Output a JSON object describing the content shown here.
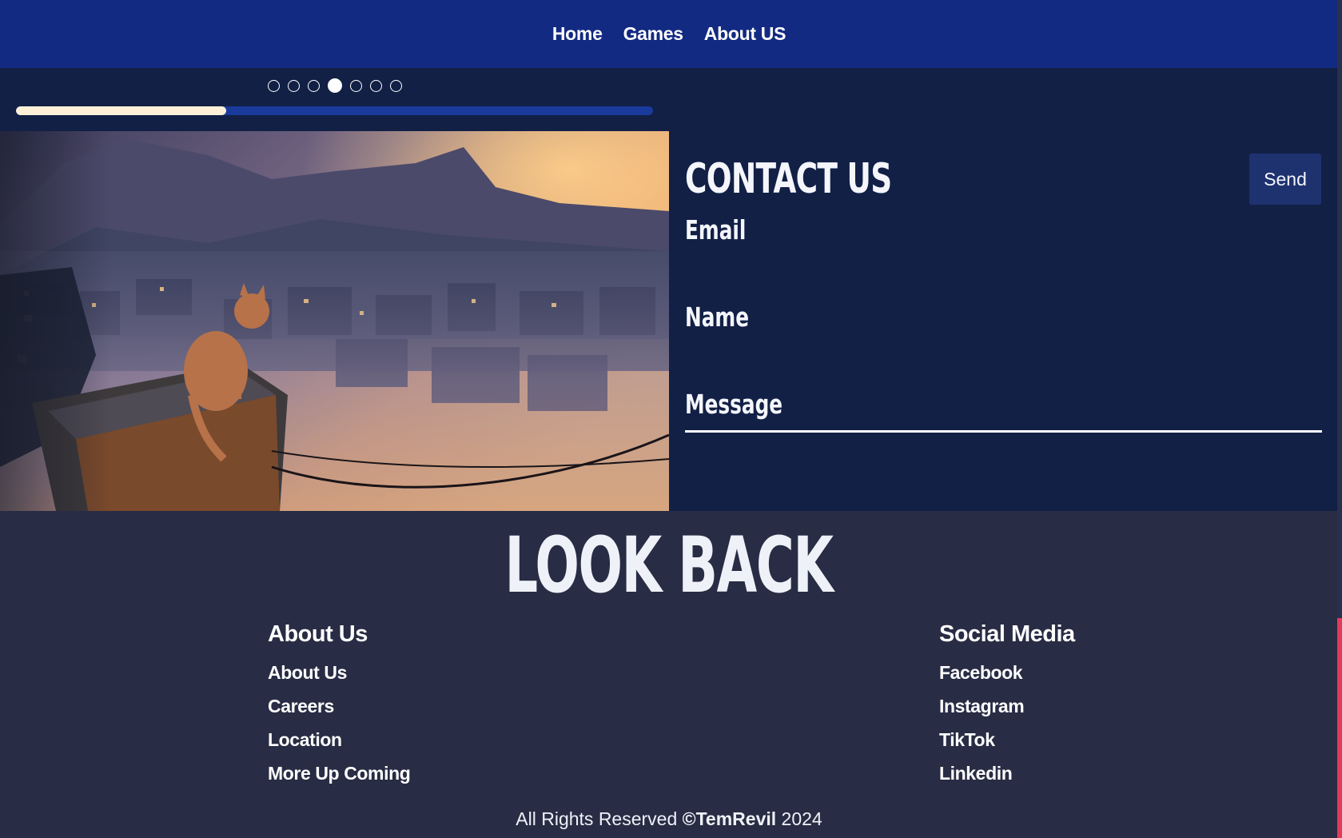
{
  "nav": {
    "items": [
      {
        "label": "Home"
      },
      {
        "label": "Games"
      },
      {
        "label": "About US"
      }
    ]
  },
  "carousel": {
    "slide_count": 7,
    "active_index": 3,
    "progress": 0.33
  },
  "contact": {
    "title": "CONTACT US",
    "send_label": "Send",
    "fields": {
      "email_label": "Email",
      "email_value": "",
      "name_label": "Name",
      "name_value": "",
      "message_label": "Message",
      "message_value": ""
    }
  },
  "footer": {
    "heading": "LOOK BACK",
    "about": {
      "title": "About Us",
      "links": [
        "About Us",
        "Careers",
        "Location",
        "More Up Coming"
      ]
    },
    "social": {
      "title": "Social Media",
      "links": [
        "Facebook",
        "Instagram",
        "TikTok",
        "Linkedin"
      ]
    },
    "copyright_prefix": "All Rights Reserved",
    "copyright_brand": "©TemRevil",
    "copyright_year": "2024"
  },
  "colors": {
    "nav_bg": "#132a82",
    "page_bg": "#122046",
    "footer_bg": "#282c44",
    "progress_track": "#1a3a9c",
    "progress_fill": "#fdf1d8",
    "send_button_bg": "#1e3270",
    "scroll_accent": "#e33a5a"
  },
  "hero": {
    "icon": "cat-on-rooftop-illustration"
  }
}
